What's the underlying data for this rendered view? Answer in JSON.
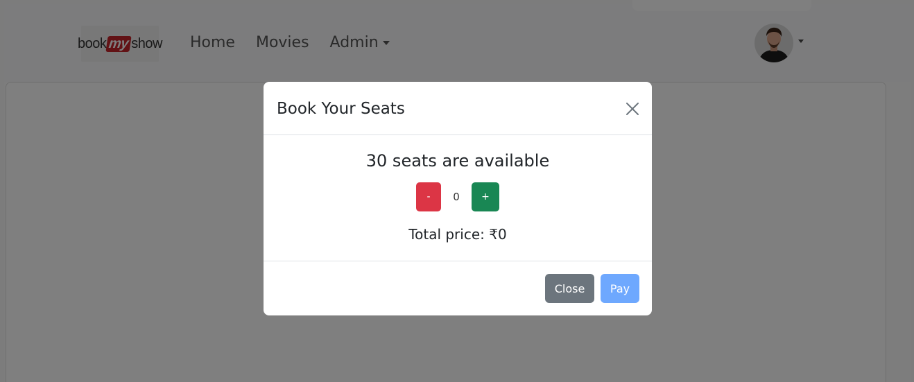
{
  "navbar": {
    "brand": {
      "part1": "book",
      "part2": "my",
      "part3": "show"
    },
    "links": [
      {
        "label": "Home"
      },
      {
        "label": "Movies"
      },
      {
        "label": "Admin"
      }
    ]
  },
  "modal": {
    "title": "Book Your Seats",
    "close_icon": "close-icon",
    "seats_available": "30 seats are available",
    "stepper": {
      "minus_label": "-",
      "value": "0",
      "plus_label": "+"
    },
    "total_price": "Total price: ₹0",
    "footer": {
      "close_label": "Close",
      "pay_label": "Pay"
    }
  },
  "colors": {
    "danger": "#dc3545",
    "success": "#198754",
    "secondary": "#6c757d",
    "primary_disabled": "#6ea8fe",
    "brand_red": "#c4242b"
  }
}
